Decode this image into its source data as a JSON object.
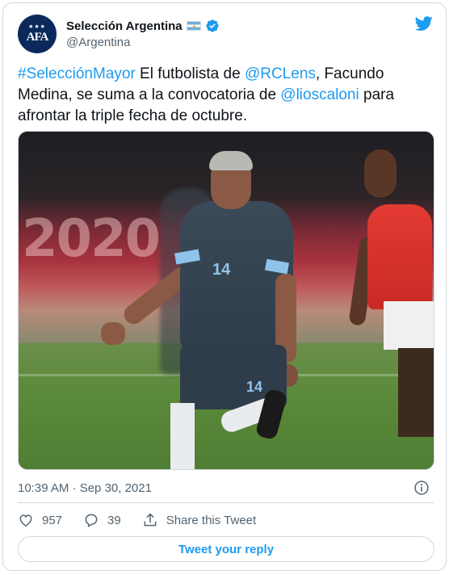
{
  "author": {
    "display_name": "Selección Argentina",
    "handle": "@Argentina",
    "avatar_text": "AFA",
    "avatar_stars": "★★★"
  },
  "tweet": {
    "segments": [
      {
        "text": "#SelecciónMayor",
        "link": true
      },
      {
        "text": " El futbolista de ",
        "link": false
      },
      {
        "text": "@RCLens",
        "link": true
      },
      {
        "text": ", Facundo Medina, se suma a la convocatoria de ",
        "link": false
      },
      {
        "text": "@lioscaloni",
        "link": true
      },
      {
        "text": " para afrontar la triple fecha de octubre.",
        "link": false
      }
    ],
    "timestamp": "10:39 AM · Sep 30, 2021"
  },
  "media": {
    "shirt_number": "14",
    "shorts_number": "14",
    "stand_text": "2020"
  },
  "actions": {
    "likes": "957",
    "replies": "39",
    "share_label": "Share this Tweet",
    "reply_button_label": "Tweet your reply"
  },
  "colors": {
    "link": "#1d9bf0",
    "secondary_text": "#536471",
    "border": "#cfd9de",
    "verified": "#1d9bf0"
  }
}
